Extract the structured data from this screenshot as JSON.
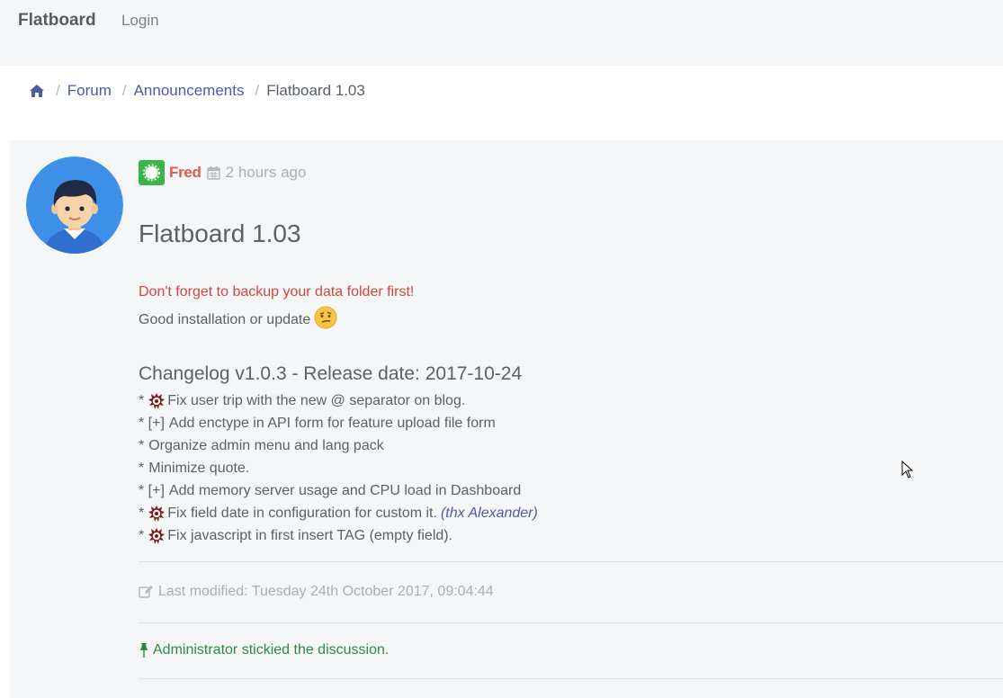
{
  "navbar": {
    "brand": "Flatboard",
    "login": "Login"
  },
  "breadcrumb": {
    "home_icon": "home-icon",
    "items": [
      "Forum",
      "Announcements"
    ],
    "active": "Flatboard 1.03"
  },
  "post": {
    "author": "Fred",
    "time": "2 hours ago",
    "title": "Flatboard 1.03",
    "warning": "Don't forget to backup your data folder first!",
    "intro": "Good installation or update",
    "changelog_title": "Changelog v1.0.3 - Release date: 2017-10-24",
    "changes": [
      {
        "prefix": "*",
        "bug": true,
        "text": "Fix user trip with the new @ separator on blog.",
        "thx": ""
      },
      {
        "prefix": "* [+]",
        "bug": false,
        "text": "Add enctype in API form for feature upload file form",
        "thx": ""
      },
      {
        "prefix": "*",
        "bug": false,
        "text": "Organize admin menu and lang pack",
        "thx": ""
      },
      {
        "prefix": "*",
        "bug": false,
        "text": "Minimize quote.",
        "thx": ""
      },
      {
        "prefix": "* [+]",
        "bug": false,
        "text": "Add memory server usage and CPU load in Dashboard",
        "thx": ""
      },
      {
        "prefix": "*",
        "bug": true,
        "text": "Fix field date in configuration for custom it.",
        "thx": "(thx Alexander)"
      },
      {
        "prefix": "*",
        "bug": true,
        "text": "Fix javascript in first insert TAG (empty field).",
        "thx": ""
      }
    ],
    "last_modified": "Last modified: Tuesday 24th October 2017, 09:04:44",
    "sticky_notice": "Administrator stickied the discussion."
  },
  "colors": {
    "accent": "#4e5aa6",
    "author": "#e05a47",
    "warning": "#d2473a",
    "success": "#2b8a47",
    "badge": "#3bb54a"
  }
}
